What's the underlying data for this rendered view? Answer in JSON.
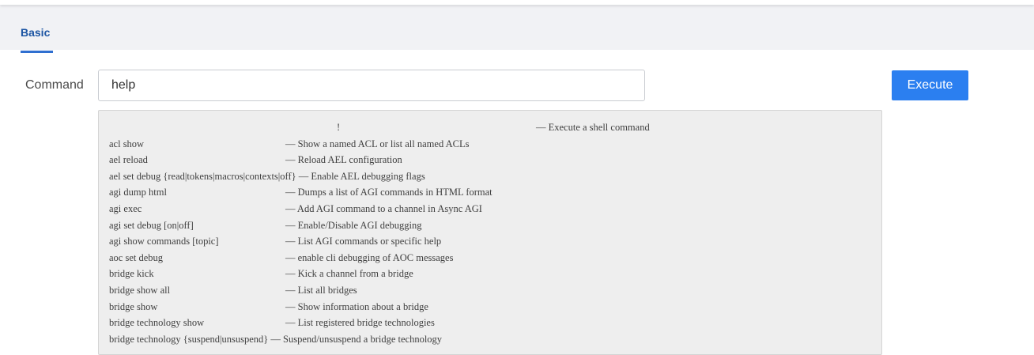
{
  "tabs": [
    {
      "label": "Basic",
      "active": true
    }
  ],
  "command": {
    "label": "Command",
    "value": "help"
  },
  "execute_button": {
    "label": "Execute"
  },
  "output": {
    "lines": [
      {
        "cmd": "!",
        "desc": "— Execute a shell command"
      },
      {
        "cmd": "acl show",
        "desc": "— Show a named ACL or list all named ACLs"
      },
      {
        "cmd": "ael reload",
        "desc": "— Reload AEL configuration"
      },
      {
        "cmd": "ael set debug {read|tokens|macros|contexts|off}",
        "desc": "— Enable AEL debugging flags"
      },
      {
        "cmd": "agi dump html",
        "desc": "— Dumps a list of AGI commands in HTML format"
      },
      {
        "cmd": "agi exec",
        "desc": "— Add AGI command to a channel in Async AGI"
      },
      {
        "cmd": "agi set debug [on|off]",
        "desc": "— Enable/Disable AGI debugging"
      },
      {
        "cmd": "agi show commands [topic]",
        "desc": "— List AGI commands or specific help"
      },
      {
        "cmd": "aoc set debug",
        "desc": "— enable cli debugging of AOC messages"
      },
      {
        "cmd": "bridge kick",
        "desc": "— Kick a channel from a bridge"
      },
      {
        "cmd": "bridge show all",
        "desc": "— List all bridges"
      },
      {
        "cmd": "bridge show",
        "desc": "— Show information about a bridge"
      },
      {
        "cmd": "bridge technology show",
        "desc": "— List registered bridge technologies"
      },
      {
        "cmd": "bridge technology {suspend|unsuspend}",
        "desc": "— Suspend/unsuspend a bridge technology"
      }
    ]
  }
}
